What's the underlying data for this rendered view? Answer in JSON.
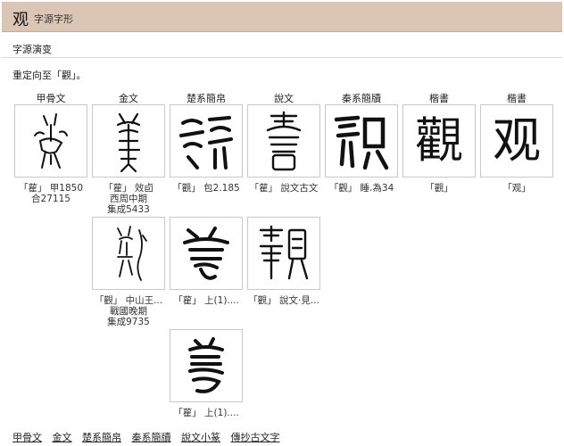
{
  "header": {
    "char": "观",
    "title": "字源字形"
  },
  "section_title": "字源演变",
  "redirect": "重定向至「觀」。",
  "columns": [
    "甲骨文",
    "金文",
    "楚系簡帛",
    "說文",
    "秦系簡牘",
    "楷書",
    "楷書"
  ],
  "cells": [
    {
      "glyph": "",
      "caption": [
        "「雚」 甲1850",
        "合27115"
      ]
    },
    {
      "glyph": "",
      "caption": [
        "「雚」 效卣",
        "西周中期",
        "集成5433"
      ]
    },
    {
      "glyph": "",
      "caption": [
        "「觀」 包2.185"
      ]
    },
    {
      "glyph": "",
      "caption": [
        "「雚」 說文古文"
      ]
    },
    {
      "glyph": "",
      "caption": [
        "「觀」 睡.為34"
      ]
    },
    {
      "glyph": "觀",
      "caption": [
        "「觀」"
      ]
    },
    {
      "glyph": "观",
      "caption": [
        "「观」"
      ]
    },
    {
      "glyph": "",
      "caption": [
        "「觀」 中山王...",
        "戰國晚期",
        "集成9735"
      ]
    },
    {
      "glyph": "",
      "caption": [
        "「雚」 上(1)...."
      ]
    },
    {
      "glyph": "",
      "caption": [
        "「觀」 說文·見..."
      ]
    },
    {
      "glyph": "",
      "caption": [
        "「雚」 上(1)...."
      ]
    }
  ],
  "footer_links": [
    "甲骨文",
    "金文",
    "楚系簡帛",
    "秦系簡牘",
    "說文小篆",
    "傳抄古文字"
  ]
}
